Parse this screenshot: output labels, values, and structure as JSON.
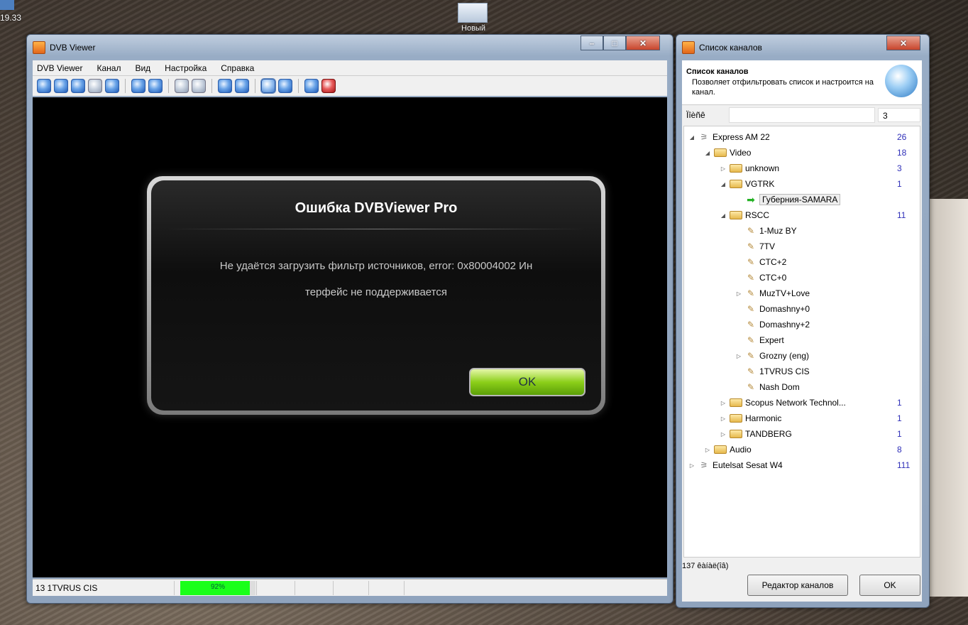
{
  "desktop": {
    "clock": "19.33",
    "icon_label": "Новый"
  },
  "dvb_window": {
    "title": "DVB Viewer",
    "menu": [
      "DVB Viewer",
      "Канал",
      "Вид",
      "Настройка",
      "Справка"
    ],
    "status": {
      "channel": "13 1TVRUS CIS",
      "signal_label": "92%",
      "signal_level": 0.92
    }
  },
  "error_dialog": {
    "title": "Ошибка DVBViewer Pro",
    "message_line1": "Не удаётся загрузить фильтр источников, error: 0x80004002 Ин",
    "message_line2": "терфейс не поддерживается",
    "ok_label": "OK"
  },
  "channel_window": {
    "title": "Список каналов",
    "header_title": "Список каналов",
    "header_desc": "Позволяет отфильтровать список и настроится на канал.",
    "filter_label": "Ïîèñê",
    "filter_count": "3",
    "tree": [
      {
        "label": "Express AM 22",
        "count": "26",
        "level": 0,
        "icon": "satellite-icon",
        "twisty": "expanded"
      },
      {
        "label": "Video",
        "count": "18",
        "level": 1,
        "icon": "folder-icon",
        "twisty": "expanded"
      },
      {
        "label": "unknown",
        "count": "3",
        "level": 2,
        "icon": "folder-icon",
        "twisty": "collapsed"
      },
      {
        "label": "VGTRK",
        "count": "1",
        "level": 2,
        "icon": "folder-icon",
        "twisty": "expanded"
      },
      {
        "label": "Губерния-SAMARA",
        "count": "",
        "level": 3,
        "icon": "current-channel-arrow-icon",
        "twisty": "",
        "selected": true
      },
      {
        "label": "RSCC",
        "count": "11",
        "level": 2,
        "icon": "folder-icon",
        "twisty": "expanded"
      },
      {
        "label": "1-Muz BY",
        "count": "",
        "level": 3,
        "icon": "channel-icon",
        "twisty": ""
      },
      {
        "label": "7TV",
        "count": "",
        "level": 3,
        "icon": "channel-icon",
        "twisty": ""
      },
      {
        "label": "CTC+2",
        "count": "",
        "level": 3,
        "icon": "channel-icon",
        "twisty": ""
      },
      {
        "label": "CTC+0",
        "count": "",
        "level": 3,
        "icon": "channel-icon",
        "twisty": ""
      },
      {
        "label": "MuzTV+Love",
        "count": "",
        "level": 3,
        "icon": "channel-icon",
        "twisty": "collapsed"
      },
      {
        "label": "Domashny+0",
        "count": "",
        "level": 3,
        "icon": "channel-icon",
        "twisty": ""
      },
      {
        "label": "Domashny+2",
        "count": "",
        "level": 3,
        "icon": "channel-icon",
        "twisty": ""
      },
      {
        "label": "Expert",
        "count": "",
        "level": 3,
        "icon": "channel-icon",
        "twisty": ""
      },
      {
        "label": "Grozny (eng)",
        "count": "",
        "level": 3,
        "icon": "channel-icon",
        "twisty": "collapsed"
      },
      {
        "label": "1TVRUS CIS",
        "count": "",
        "level": 3,
        "icon": "channel-icon",
        "twisty": ""
      },
      {
        "label": "Nash Dom",
        "count": "",
        "level": 3,
        "icon": "channel-icon",
        "twisty": ""
      },
      {
        "label": "Scopus Network Technol...",
        "count": "1",
        "level": 2,
        "icon": "folder-icon",
        "twisty": "collapsed"
      },
      {
        "label": "Harmonic",
        "count": "1",
        "level": 2,
        "icon": "folder-icon",
        "twisty": "collapsed"
      },
      {
        "label": "TANDBERG",
        "count": "1",
        "level": 2,
        "icon": "folder-icon",
        "twisty": "collapsed"
      },
      {
        "label": "Audio",
        "count": "8",
        "level": 1,
        "icon": "folder-icon",
        "twisty": "collapsed"
      },
      {
        "label": "Eutelsat Sesat W4",
        "count": "111",
        "level": 0,
        "icon": "satellite-icon",
        "twisty": "collapsed"
      }
    ],
    "footer_count": "137 êàíàë(îâ)",
    "editor_button": "Редактор каналов",
    "ok_button": "OK"
  }
}
